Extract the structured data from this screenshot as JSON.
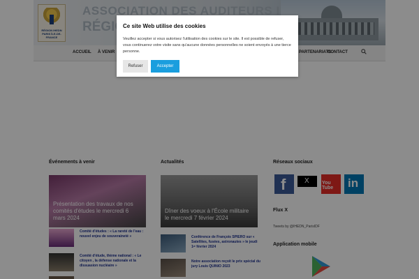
{
  "header": {
    "logo_text": "RÉGION IHEDN PARIS ÎLE-DE-FRANCE",
    "title_line1": "ASSOCIATION DES AUDITEURS IHEDN",
    "title_line2": "RÉGION"
  },
  "nav": {
    "items": [
      "Accueil",
      "À venir",
      "Partenariats",
      "Contact"
    ]
  },
  "columns": {
    "events": {
      "title": "Événements à venir",
      "feature_caption": "Présentation des travaux de nos comités d'études le mercredi 6 mars 2024",
      "items": [
        "Comité d'études : « La rareté de l'eau : nouvel enjeu de souveraineté »",
        "Comité d'étude, thème national : « Le citoyen , la défense nationale et la dissuasion nucléaire »"
      ]
    },
    "news": {
      "title": "Actualités",
      "feature_caption": "Dîner des voeux à l'École militaire le mercredi 7 février 2024",
      "items": [
        "Conférence de François SPIERO sur « Satellites, fusées, astronautes » le jeudi 1ᵉʳ février 2024",
        "Notre association reçoit le prix spécial du jury Louis QUINIO 2023"
      ]
    },
    "social": {
      "title": "Réseaux sociaux",
      "icons": [
        "facebook-icon",
        "x-icon",
        "youtube-icon",
        "linkedin-icon"
      ],
      "x_label": "X",
      "youtube_label": "You Tube",
      "linkedin_label": "in",
      "facebook_label": "f",
      "flux_title": "Flux X",
      "tweets_label": "Tweets by @IHEDN_ParisIDF",
      "app_title": "Application mobile"
    }
  },
  "cookie": {
    "title": "Ce site Web utilise des cookies",
    "text": "Veuillez accepter si vous autorisez l'utilisation des cookies sur le site. Il est possible de refuser, vous continuerez votre visite sans qu'aucune données personnelles ne soient envoyés à une tierce personne.",
    "refuse_label": "Refuser",
    "accept_label": "Accepter"
  },
  "colors": {
    "accent": "#1a9ede",
    "link": "#1b2f8f",
    "facebook": "#3b5998",
    "youtube": "#e52d27",
    "linkedin": "#0077b5"
  }
}
